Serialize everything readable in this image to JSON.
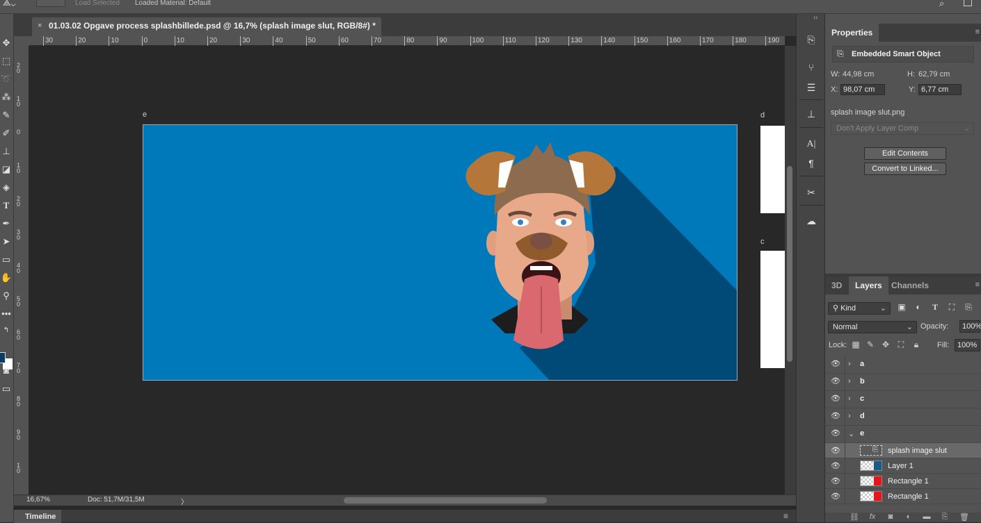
{
  "options_bar": {
    "load_selected": "Load Selected",
    "material": "Loaded Material: Default"
  },
  "document": {
    "tab_title": "01.03.02 Opgave process splashbillede.psd @ 16,7% (splash image slut, RGB/8#) *",
    "close_glyph": "×"
  },
  "ruler": {
    "top_ticks": [
      "30",
      "20",
      "10",
      "0",
      "10",
      "20",
      "30",
      "40",
      "50",
      "60",
      "70",
      "80",
      "90",
      "100",
      "110",
      "120",
      "130",
      "140",
      "150",
      "160",
      "170",
      "180",
      "190"
    ],
    "left_ticks": [
      "2\n0",
      "1\n0",
      "0",
      "1\n0",
      "2\n0",
      "3\n0",
      "4\n0",
      "5\n0",
      "6\n0",
      "7\n0",
      "8\n0",
      "9\n0",
      "1\n0"
    ]
  },
  "canvas": {
    "artboards": [
      {
        "label": "e",
        "color": "#0079bb"
      },
      {
        "label": "d",
        "color": "#ffffff"
      },
      {
        "label": "c",
        "color": "#ffffff"
      }
    ]
  },
  "status": {
    "zoom": "16,67%",
    "doc": "Doc: 51,7M/31,5M",
    "arrow": "〉"
  },
  "timeline": {
    "label": "Timeline",
    "menu": "≡"
  },
  "properties": {
    "tab": "Properties",
    "type": "Embedded Smart Object",
    "w_label": "W:",
    "w_value": "44,98 cm",
    "h_label": "H:",
    "h_value": "62,79 cm",
    "x_label": "X:",
    "x_value": "98,07 cm",
    "y_label": "Y:",
    "y_value": "6,77 cm",
    "filename": "splash image slut.png",
    "layer_comp": "Don't Apply Layer Comp",
    "edit_button": "Edit Contents",
    "convert_button": "Convert to Linked..."
  },
  "layers_panel": {
    "tabs": [
      "3D",
      "Layers",
      "Channels"
    ],
    "active_tab": "Layers",
    "kind": "Kind",
    "blend_mode": "Normal",
    "opacity_label": "Opacity:",
    "opacity": "100%",
    "lock_label": "Lock:",
    "fill_label": "Fill:",
    "fill": "100%",
    "layers": [
      {
        "name": "a",
        "type": "group",
        "expanded": false
      },
      {
        "name": "b",
        "type": "group",
        "expanded": false
      },
      {
        "name": "c",
        "type": "group",
        "expanded": false
      },
      {
        "name": "d",
        "type": "group",
        "expanded": false
      },
      {
        "name": "e",
        "type": "group",
        "expanded": true
      },
      {
        "name": "splash image slut",
        "type": "smart-object",
        "selected": true
      },
      {
        "name": "Layer 1",
        "type": "pixel",
        "accent": "#1a5a8a"
      },
      {
        "name": "Rectangle 1",
        "type": "shape",
        "accent": "#e8141c"
      },
      {
        "name": "Rectangle 1",
        "type": "shape",
        "accent": "#e8141c"
      }
    ]
  },
  "colors": {
    "foreground": "#0a3a66",
    "background": "#ffffff",
    "artboard_blue": "#0079bb"
  }
}
